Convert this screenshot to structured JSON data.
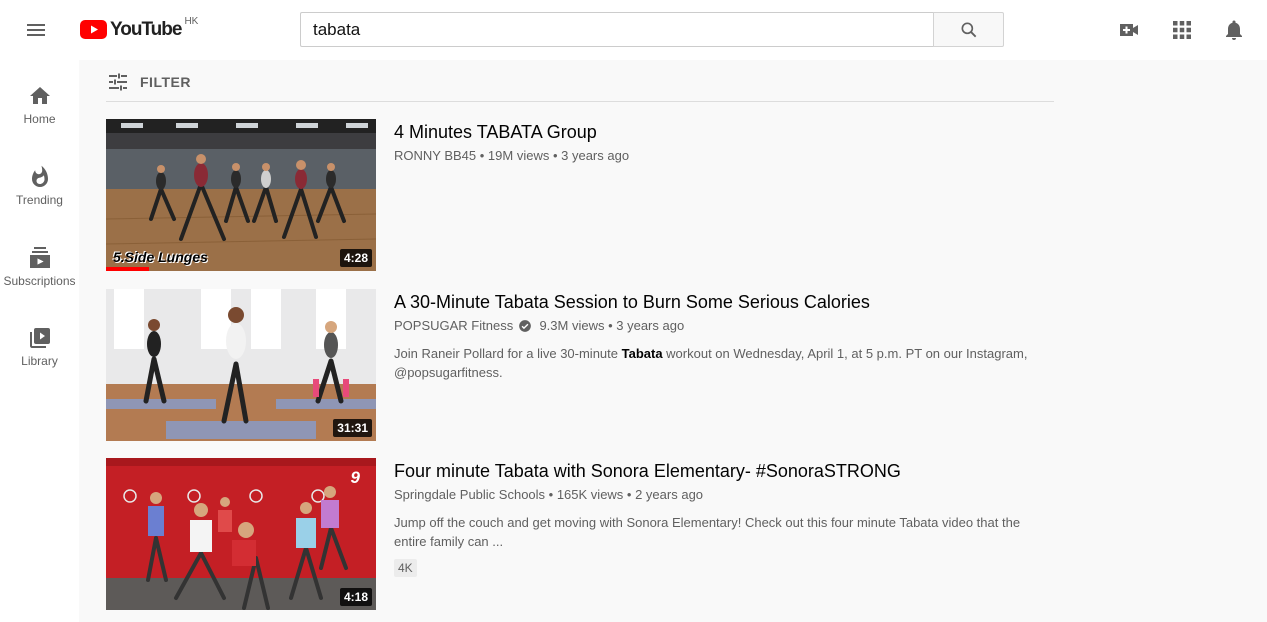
{
  "header": {
    "logo_text": "YouTube",
    "region": "HK",
    "search_query": "tabata"
  },
  "sidebar": {
    "items": [
      {
        "label": "Home",
        "icon": "home-icon"
      },
      {
        "label": "Trending",
        "icon": "flame-icon"
      },
      {
        "label": "Subscriptions",
        "icon": "subscriptions-icon"
      },
      {
        "label": "Library",
        "icon": "library-icon"
      }
    ]
  },
  "filter": {
    "label": "FILTER"
  },
  "results": [
    {
      "title": "4 Minutes TABATA Group",
      "channel": "RONNY BB45",
      "views": "19M views",
      "age": "3 years ago",
      "duration": "4:28",
      "thumb_caption": "5.Side Lunges",
      "watch_progress": 0.16
    },
    {
      "title": "A 30-Minute Tabata Session to Burn Some Serious Calories",
      "channel": "POPSUGAR Fitness",
      "verified": true,
      "views": "9.3M views",
      "age": "3 years ago",
      "duration": "31:31",
      "desc_before": "Join Raneir Pollard for a live 30-minute ",
      "desc_bold": "Tabata",
      "desc_after": " workout on Wednesday, April 1, at 5 p.m. PT on our Instagram, @popsugarfitness."
    },
    {
      "title": "Four minute Tabata with Sonora Elementary- #SonoraSTRONG",
      "channel": "Springdale Public Schools",
      "views": "165K views",
      "age": "2 years ago",
      "duration": "4:18",
      "thumb_number": "9",
      "description": "Jump off the couch and get moving with Sonora Elementary! Check out this four minute Tabata video that the entire family can ...",
      "badge": "4K"
    }
  ],
  "colors": {
    "brand_red": "#ff0000",
    "text_primary": "#030303",
    "text_secondary": "#606060",
    "page_bg": "#f9f9f9"
  }
}
